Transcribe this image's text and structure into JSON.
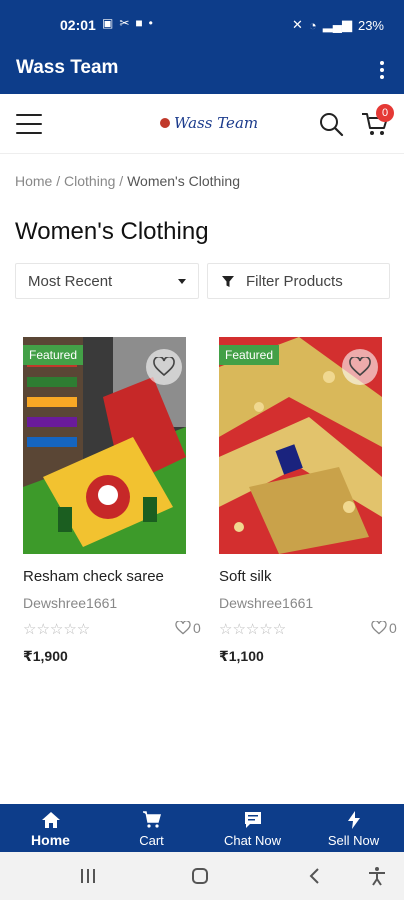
{
  "status_bar": {
    "time": "02:01",
    "battery": "23%",
    "icons_left": [
      "gallery-icon",
      "tools-icon",
      "bag-icon",
      "dot-icon"
    ],
    "icons_right": [
      "mute-icon",
      "wifi-icon",
      "signal-icon",
      "signal-icon"
    ]
  },
  "app_bar": {
    "title": "Wass Team"
  },
  "header": {
    "logo_text": "Wass Team",
    "cart_count": "0"
  },
  "breadcrumb": {
    "items": [
      "Home",
      "Clothing"
    ],
    "separator": " / ",
    "current": "Women's Clothing"
  },
  "page": {
    "title": "Women's Clothing"
  },
  "controls": {
    "sort_label": "Most Recent",
    "filter_label": "Filter Products"
  },
  "products": [
    {
      "badge": "Featured",
      "name": "Resham check saree",
      "seller": "Dewshree1661",
      "stars": "☆☆☆☆☆",
      "rating": 0,
      "likes": "0",
      "price": "₹1,900"
    },
    {
      "badge": "Featured",
      "name": "Soft silk",
      "seller": "Dewshree1661",
      "stars": "☆☆☆☆☆",
      "rating": 0,
      "likes": "0",
      "price": "₹1,100"
    }
  ],
  "bottom_nav": [
    {
      "label": "Home",
      "icon": "home-icon",
      "active": true
    },
    {
      "label": "Cart",
      "icon": "cart-icon",
      "active": false
    },
    {
      "label": "Chat Now",
      "icon": "chat-icon",
      "active": false
    },
    {
      "label": "Sell Now",
      "icon": "bolt-icon",
      "active": false
    }
  ],
  "colors": {
    "primary": "#0d3d8a",
    "badge_green": "#43a047",
    "cart_badge": "#e53935"
  }
}
